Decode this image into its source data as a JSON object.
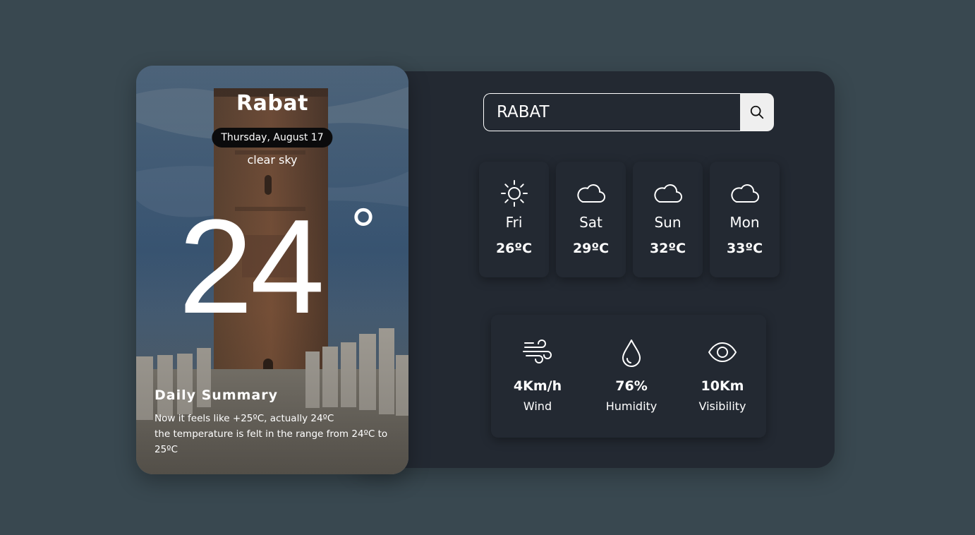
{
  "city": {
    "name": "Rabat",
    "date": "Thursday, August 17",
    "condition": "clear sky",
    "temperature": "24",
    "degree_symbol": "°",
    "summary_title": "Daily Summary",
    "summary_line1": "Now it feels like +25ºC, actually 24ºC",
    "summary_line2": "the temperature is felt in the range from 24ºC to 25ºC"
  },
  "search": {
    "value": "RABAT",
    "button_icon": "search-icon"
  },
  "forecast": [
    {
      "day": "Fri",
      "temp": "26ºC",
      "icon": "sun-icon"
    },
    {
      "day": "Sat",
      "temp": "29ºC",
      "icon": "cloud-icon"
    },
    {
      "day": "Sun",
      "temp": "32ºC",
      "icon": "cloud-icon"
    },
    {
      "day": "Mon",
      "temp": "33ºC",
      "icon": "cloud-icon"
    }
  ],
  "stats": {
    "wind": {
      "value": "4Km/h",
      "label": "Wind",
      "icon": "wind-icon"
    },
    "humidity": {
      "value": "76%",
      "label": "Humidity",
      "icon": "droplet-icon"
    },
    "visibility": {
      "value": "10Km",
      "label": "Visibility",
      "icon": "eye-icon"
    }
  },
  "colors": {
    "page_background": "#394850",
    "panel_background": "#232932",
    "search_button": "#efefef"
  }
}
